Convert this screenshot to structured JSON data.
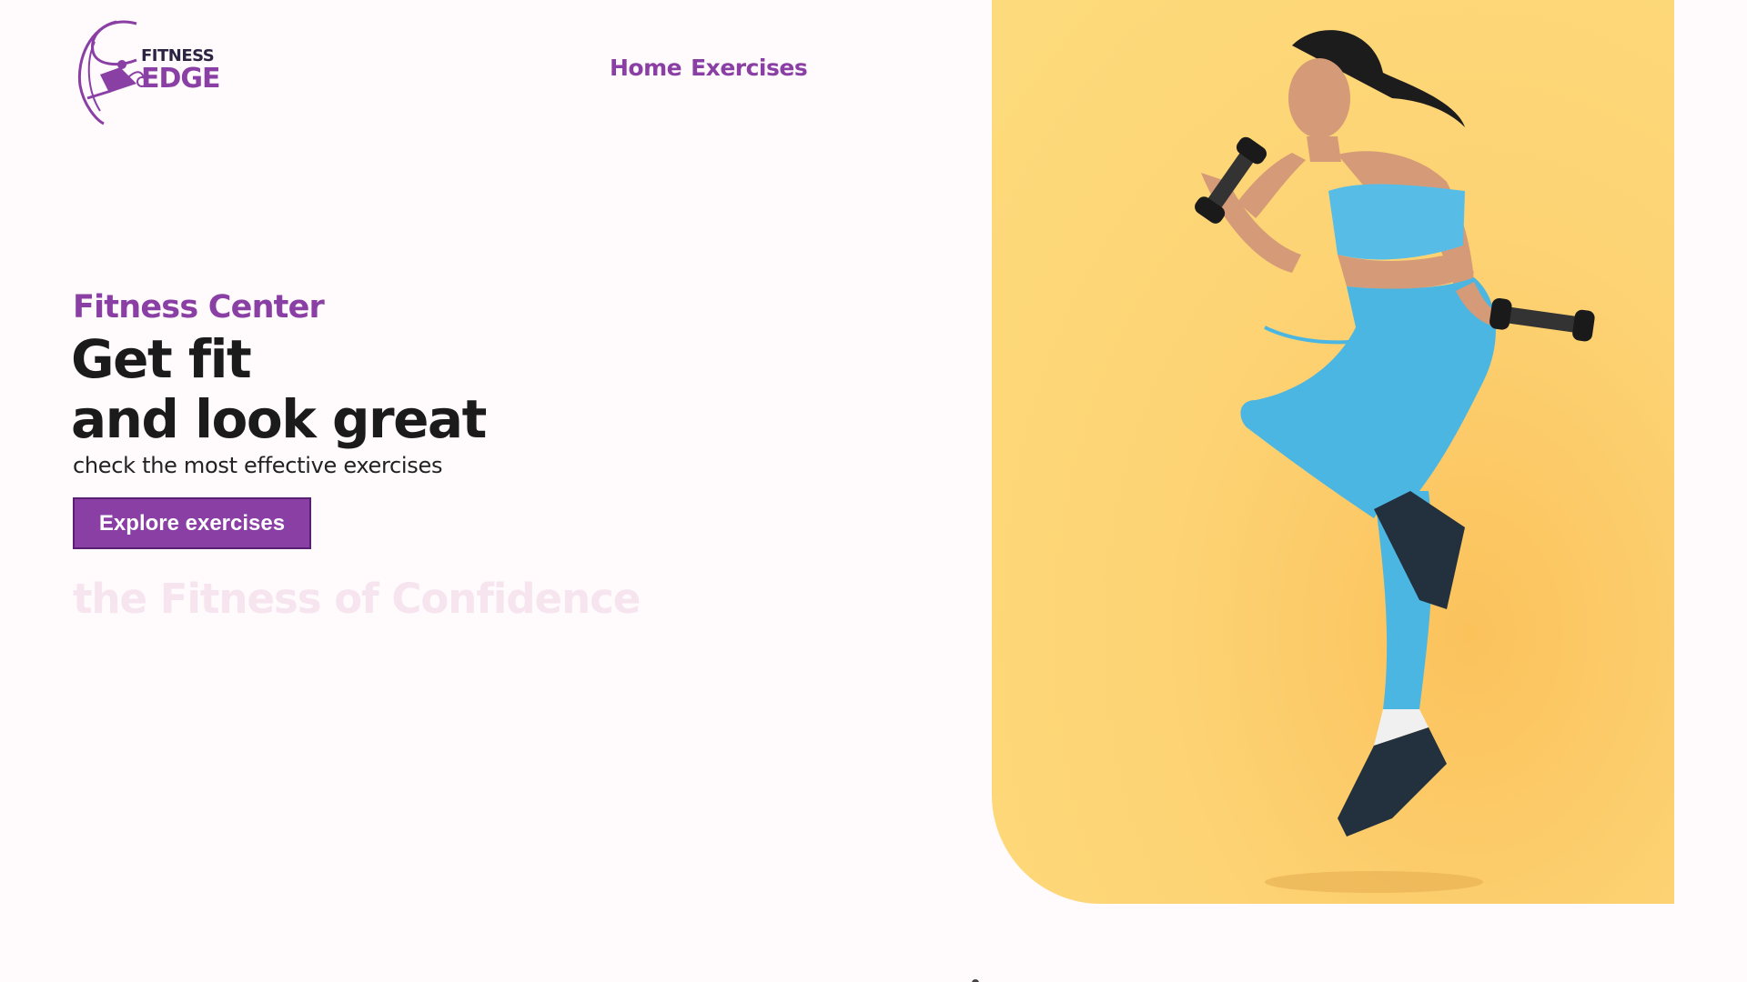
{
  "brand": {
    "line1": "FITNESS",
    "line2": "EDGE",
    "colors": {
      "primary": "#8a3fa5",
      "dark": "#2b2342"
    }
  },
  "nav": {
    "items": [
      {
        "label": "Home"
      },
      {
        "label": "Exercises"
      }
    ]
  },
  "hero": {
    "eyebrow": "Fitness Center",
    "title_line1": "Get fit",
    "title_line2": "and look great",
    "subtitle": "check the most effective exercises",
    "cta_label": "Explore exercises",
    "watermark": "the Fitness of Confidence",
    "image_icon": "woman-jumping-with-dumbbells",
    "image_background": "#fdd374"
  }
}
